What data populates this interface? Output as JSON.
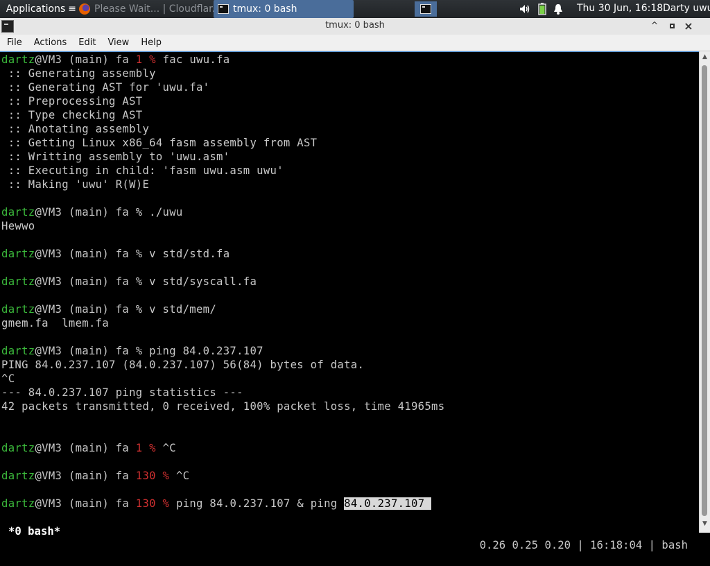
{
  "panel": {
    "apps_label": "Applications",
    "tasks": [
      {
        "title": "Please Wait... | Cloudflar..."
      },
      {
        "title": "tmux: 0 bash"
      }
    ],
    "clock": "Thu 30 Jun, 16:18",
    "user": "Darty uwu",
    "battery_color": "#7bd148"
  },
  "window": {
    "title": "tmux: 0 bash",
    "buttons": {
      "minimize": "^",
      "close": "×"
    }
  },
  "menu": [
    "File",
    "Actions",
    "Edit",
    "View",
    "Help"
  ],
  "colors": {
    "prompt_user": "#3bb93b",
    "error_status": "#d03030",
    "text": "#c8c8c8",
    "scroll_accent": "#4a90d9"
  },
  "terminal": {
    "lines": [
      {
        "t": "prompt",
        "user": "dartz",
        "host": "@VM3 (main) fa ",
        "status": "1",
        "cmd": "fac uwu.fa"
      },
      {
        "t": "out",
        "text": " :: Generating assembly"
      },
      {
        "t": "out",
        "text": " :: Generating AST for 'uwu.fa'"
      },
      {
        "t": "out",
        "text": " :: Preprocessing AST"
      },
      {
        "t": "out",
        "text": " :: Type checking AST"
      },
      {
        "t": "out",
        "text": " :: Anotating assembly"
      },
      {
        "t": "out",
        "text": " :: Getting Linux x86_64 fasm assembly from AST"
      },
      {
        "t": "out",
        "text": " :: Writting assembly to 'uwu.asm'"
      },
      {
        "t": "out",
        "text": " :: Executing in child: 'fasm uwu.asm uwu'"
      },
      {
        "t": "out",
        "text": " :: Making 'uwu' R(W)E"
      },
      {
        "t": "out",
        "text": ""
      },
      {
        "t": "prompt",
        "user": "dartz",
        "host": "@VM3 (main) fa ",
        "status": "",
        "cmd": "./uwu"
      },
      {
        "t": "out",
        "text": "Hewwo"
      },
      {
        "t": "out",
        "text": ""
      },
      {
        "t": "prompt",
        "user": "dartz",
        "host": "@VM3 (main) fa ",
        "status": "",
        "cmd": "v std/std.fa"
      },
      {
        "t": "out",
        "text": ""
      },
      {
        "t": "prompt",
        "user": "dartz",
        "host": "@VM3 (main) fa ",
        "status": "",
        "cmd": "v std/syscall.fa"
      },
      {
        "t": "out",
        "text": ""
      },
      {
        "t": "prompt",
        "user": "dartz",
        "host": "@VM3 (main) fa ",
        "status": "",
        "cmd": "v std/mem/"
      },
      {
        "t": "out",
        "text": "gmem.fa  lmem.fa"
      },
      {
        "t": "out",
        "text": ""
      },
      {
        "t": "prompt",
        "user": "dartz",
        "host": "@VM3 (main) fa ",
        "status": "",
        "cmd": "ping 84.0.237.107"
      },
      {
        "t": "out",
        "text": "PING 84.0.237.107 (84.0.237.107) 56(84) bytes of data."
      },
      {
        "t": "out",
        "text": "^C"
      },
      {
        "t": "out",
        "text": "--- 84.0.237.107 ping statistics ---"
      },
      {
        "t": "out",
        "text": "42 packets transmitted, 0 received, 100% packet loss, time 41965ms"
      },
      {
        "t": "out",
        "text": ""
      },
      {
        "t": "out",
        "text": ""
      },
      {
        "t": "prompt",
        "user": "dartz",
        "host": "@VM3 (main) fa ",
        "status": "1",
        "cmd": "^C"
      },
      {
        "t": "out",
        "text": ""
      },
      {
        "t": "prompt",
        "user": "dartz",
        "host": "@VM3 (main) fa ",
        "status": "130",
        "cmd": "^C"
      },
      {
        "t": "out",
        "text": ""
      },
      {
        "t": "prompt",
        "user": "dartz",
        "host": "@VM3 (main) fa ",
        "status": "130",
        "cmd": "ping 84.0.237.107 & ping ",
        "selected": "84.0.237.107 "
      }
    ]
  },
  "status_bar": {
    "window": "*0 bash*",
    "right": "0.26 0.25 0.20 | 16:18:04 | bash"
  }
}
